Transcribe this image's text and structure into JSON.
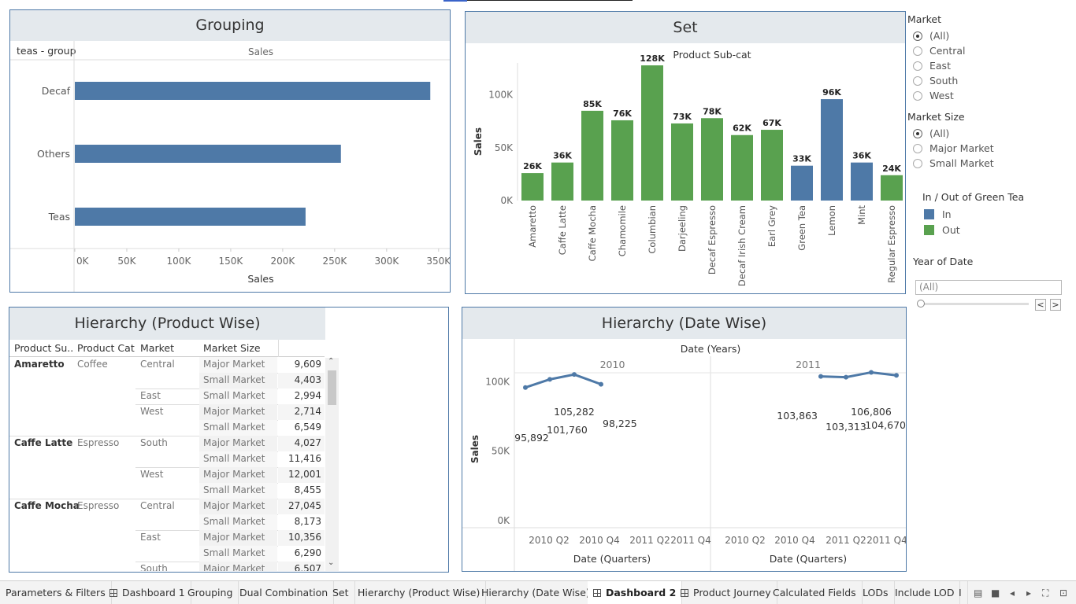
{
  "grouping": {
    "title": "Grouping",
    "row_header": "teas - group",
    "col_header": "Sales",
    "axis_label": "Sales",
    "chart_data": {
      "type": "bar",
      "orientation": "horizontal",
      "categories": [
        "Decaf",
        "Others",
        "Teas"
      ],
      "values": [
        342000,
        256000,
        222000
      ],
      "xlabel": "Sales",
      "xlim": [
        0,
        360000
      ],
      "ticks": [
        "0K",
        "50K",
        "100K",
        "150K",
        "200K",
        "250K",
        "300K",
        "350K"
      ],
      "color": "#4e79a7"
    }
  },
  "set": {
    "title": "Set",
    "chart_data": {
      "type": "bar",
      "title": "Product  Sub-cat",
      "ylabel": "Sales",
      "ylim": [
        0,
        140000
      ],
      "yticks": [
        "0K",
        "50K",
        "100K"
      ],
      "categories": [
        "Amaretto",
        "Caffe Latte",
        "Caffe Mocha",
        "Chamomile",
        "Columbian",
        "Darjeeling",
        "Decaf Espresso",
        "Decaf Irish Cream",
        "Earl Grey",
        "Green Tea",
        "Lemon",
        "Mint",
        "Regular Espresso"
      ],
      "values": [
        26000,
        36000,
        85000,
        76000,
        128000,
        73000,
        78000,
        62000,
        67000,
        33000,
        96000,
        36000,
        24000
      ],
      "labels": [
        "26K",
        "36K",
        "85K",
        "76K",
        "128K",
        "73K",
        "78K",
        "62K",
        "67K",
        "33K",
        "96K",
        "36K",
        "24K"
      ],
      "group": [
        "Out",
        "Out",
        "Out",
        "Out",
        "Out",
        "Out",
        "Out",
        "Out",
        "Out",
        "In",
        "In",
        "In",
        "Out"
      ],
      "colors": {
        "In": "#4e79a7",
        "Out": "#59a14f"
      }
    }
  },
  "filters": {
    "market": {
      "title": "Market",
      "options": [
        "(All)",
        "Central",
        "East",
        "South",
        "West"
      ],
      "selected": 0
    },
    "market_size": {
      "title": "Market Size",
      "options": [
        "(All)",
        "Major Market",
        "Small Market"
      ],
      "selected": 0
    },
    "legend": {
      "title": "In / Out of Green Tea",
      "items": [
        {
          "label": "In",
          "color": "#4e79a7"
        },
        {
          "label": "Out",
          "color": "#59a14f"
        }
      ]
    },
    "year_of_date": {
      "title": "Year of Date",
      "value": "(All)",
      "prev_label": "<",
      "next_label": ">"
    }
  },
  "hier_product": {
    "title": "Hierarchy (Product Wise)",
    "headers": [
      "Product  Su..",
      "Product Cat",
      "Market",
      "Market Size"
    ],
    "rows": [
      {
        "sub": "Amaretto",
        "cat": "Coffee",
        "market": "Central",
        "size": "Major Market",
        "value": "9,609"
      },
      {
        "sub": "",
        "cat": "",
        "market": "",
        "size": "Small Market",
        "value": "4,403"
      },
      {
        "sub": "",
        "cat": "",
        "market": "East",
        "size": "Small Market",
        "value": "2,994"
      },
      {
        "sub": "",
        "cat": "",
        "market": "West",
        "size": "Major Market",
        "value": "2,714"
      },
      {
        "sub": "",
        "cat": "",
        "market": "",
        "size": "Small Market",
        "value": "6,549"
      },
      {
        "sub": "Caffe Latte",
        "cat": "Espresso",
        "market": "South",
        "size": "Major Market",
        "value": "4,027"
      },
      {
        "sub": "",
        "cat": "",
        "market": "",
        "size": "Small Market",
        "value": "11,416"
      },
      {
        "sub": "",
        "cat": "",
        "market": "West",
        "size": "Major Market",
        "value": "12,001"
      },
      {
        "sub": "",
        "cat": "",
        "market": "",
        "size": "Small Market",
        "value": "8,455"
      },
      {
        "sub": "Caffe Mocha",
        "cat": "Espresso",
        "market": "Central",
        "size": "Major Market",
        "value": "27,045"
      },
      {
        "sub": "",
        "cat": "",
        "market": "",
        "size": "Small Market",
        "value": "8,173"
      },
      {
        "sub": "",
        "cat": "",
        "market": "East",
        "size": "Major Market",
        "value": "10,356"
      },
      {
        "sub": "",
        "cat": "",
        "market": "",
        "size": "Small Market",
        "value": "6,290"
      },
      {
        "sub": "",
        "cat": "",
        "market": "South",
        "size": "Major Market",
        "value": "6,507"
      }
    ]
  },
  "hier_date": {
    "title": "Hierarchy (Date Wise)",
    "chart_data": {
      "type": "line",
      "title": "Date (Years)",
      "ylabel": "Sales",
      "ylim": [
        0,
        115000
      ],
      "yticks": [
        "0K",
        "50K",
        "100K"
      ],
      "panels": [
        {
          "year": "2010",
          "x": [
            "2010 Q1",
            "2010 Q2",
            "2010 Q3",
            "2010 Q4"
          ],
          "values": [
            95892,
            101760,
            105282,
            98225
          ],
          "labels": [
            "95,892",
            "101,760",
            "105,282",
            "98,225"
          ],
          "ticks": [
            "2010 Q2",
            "2010 Q4"
          ]
        },
        {
          "year": "2011",
          "x": [
            "2011 Q1",
            "2011 Q2",
            "2011 Q3",
            "2011 Q4"
          ],
          "values": [
            103863,
            103313,
            106806,
            104670
          ],
          "labels": [
            "103,863",
            "103,313",
            "106,806",
            "104,670"
          ],
          "ticks": [
            "2010 Q2",
            "2010 Q4",
            "2011 Q2",
            "2011 Q4"
          ]
        }
      ],
      "left_ticks": [
        "2010 Q2",
        "2010 Q4",
        "2011 Q2",
        "2011 Q4"
      ],
      "xlabel": "Date (Quarters)",
      "color": "#4e79a7"
    }
  },
  "tabs": [
    {
      "label": "Parameters & Filters",
      "icon": ""
    },
    {
      "label": "Dashboard 1",
      "icon": "dashboard-icon"
    },
    {
      "label": "Grouping",
      "icon": ""
    },
    {
      "label": "Dual Combination",
      "icon": ""
    },
    {
      "label": "Set",
      "icon": ""
    },
    {
      "label": "Hierarchy (Product Wise)",
      "icon": ""
    },
    {
      "label": "Hierarchy (Date Wise)",
      "icon": ""
    },
    {
      "label": "Dashboard 2",
      "icon": "dashboard-icon",
      "active": true
    },
    {
      "label": "Product Journey",
      "icon": "dashboard-icon"
    },
    {
      "label": "Calculated Fields",
      "icon": ""
    },
    {
      "label": "LODs",
      "icon": ""
    },
    {
      "label": "Include LOD",
      "icon": ""
    },
    {
      "label": "I",
      "icon": ""
    }
  ]
}
